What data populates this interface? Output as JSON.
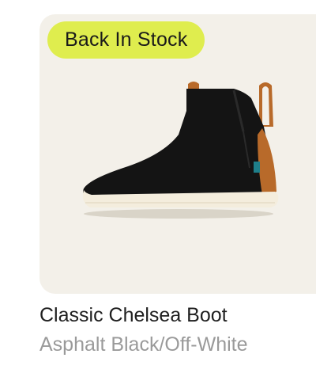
{
  "product": {
    "badge": "Back In Stock",
    "name": "Classic Chelsea Boot",
    "color": "Asphalt Black/Off-White",
    "image_icon": "chelsea-boot-image"
  },
  "colors": {
    "card_background": "#f3f0e9",
    "badge_background": "#dfed4e",
    "name_text": "#1f1f1f",
    "color_text": "#9a9a9a"
  }
}
